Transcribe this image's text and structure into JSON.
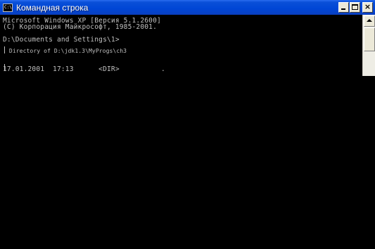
{
  "window": {
    "title": "Командная строка",
    "icon_label": "C:\\",
    "icon_name": "cmd-icon"
  },
  "console": {
    "lines": [
      "Microsoft Windows XP [Версия 5.1.2600]",
      "(С) Корпорация Майкрософт, 1985-2001.",
      "",
      "D:\\Documents and Settings\\1>",
      " Directory of D:\\jdk1.3\\MyProgs\\ch3",
      "",
      "17.01.2001  17:13      <DIR>          ."
    ]
  },
  "colors": {
    "titlebar": "#0046d5",
    "console_bg": "#000000",
    "console_text": "#c0c0c0"
  }
}
